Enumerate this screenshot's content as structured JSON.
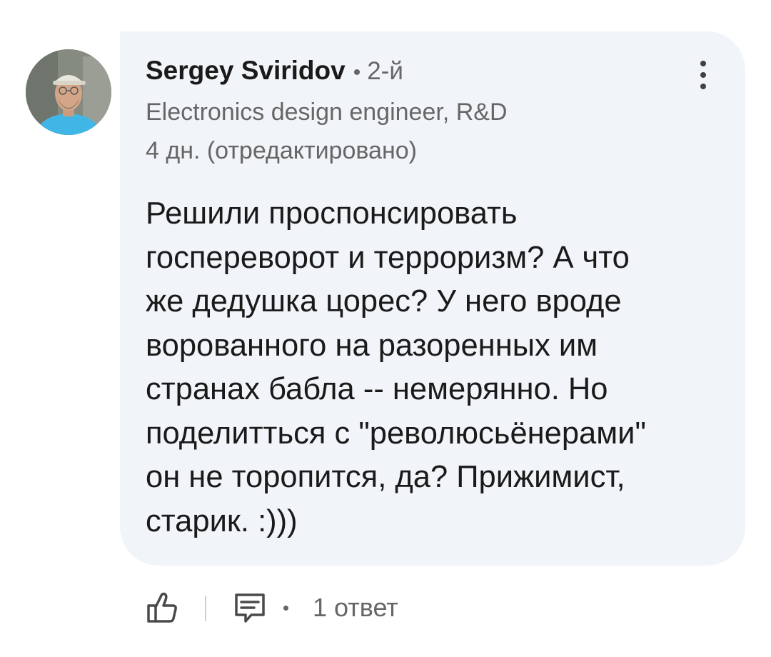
{
  "comment": {
    "author": {
      "name": "Sergey Sviridov",
      "separator": "•",
      "degree": "2-й",
      "headline": "Electronics design engineer, R&D",
      "avatar_icon": "profile-photo"
    },
    "timestamp": "4 дн. (отредактировано)",
    "text": "Решили проспонсировать\nгоспереворот и терроризм? А что\nже дедушка цорес? У него вроде\nворованного на разоренных им\nстранах бабла -- немерянно. Но\nподелитться с \"революсьёнерами\"\nон не торопится, да? Прижимист,\nстарик. :)))",
    "more_icon": "more-vertical-icon"
  },
  "actions": {
    "like_icon": "thumbs-up-icon",
    "reply_icon": "comment-reply-icon",
    "separator": "•",
    "reply_count": "1 ответ"
  },
  "colors": {
    "bubble_background": "#f1f4f8",
    "primary_text": "#1a1a1a",
    "secondary_text": "#666666",
    "avatar_shirt": "#3fb6e6"
  }
}
